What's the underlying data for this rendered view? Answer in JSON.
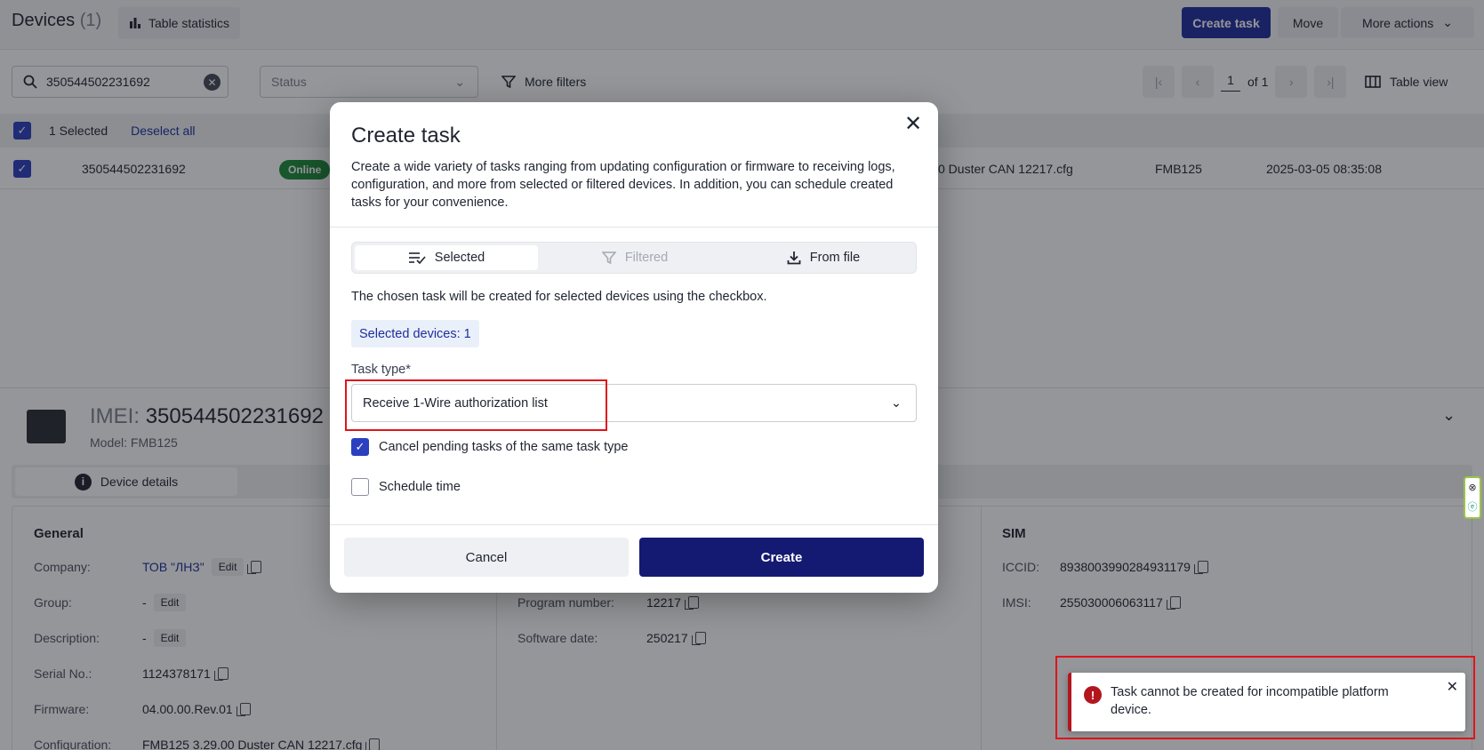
{
  "header": {
    "title": "Devices",
    "count": "(1)",
    "stats_label": "Table statistics",
    "create_task_label": "Create task",
    "move_label": "Move",
    "more_actions_label": "More actions"
  },
  "filters": {
    "search_value": "350544502231692",
    "status_placeholder": "Status",
    "more_filters_label": "More filters",
    "page_current": "1",
    "page_total": "of 1",
    "table_view_label": "Table view"
  },
  "selection": {
    "count_label": "1 Selected",
    "deselect_label": "Deselect all"
  },
  "table_row": {
    "imei": "350544502231692",
    "status": "Online",
    "configuration": "0 Duster CAN 12217.cfg",
    "model": "FMB125",
    "seen": "2025-03-05 08:35:08"
  },
  "details": {
    "imei_label": "IMEI:",
    "imei_value": "350544502231692",
    "model_text": "Model: FMB125",
    "tab_device_details": "Device details",
    "general_title": "General",
    "sim_title": "SIM",
    "general": [
      {
        "key": "Company:",
        "value": "ТОВ \"ЛНЗ\"",
        "edit": "Edit"
      },
      {
        "key": "Group:",
        "value": "-",
        "edit": "Edit"
      },
      {
        "key": "Description:",
        "value": "-",
        "edit": "Edit"
      },
      {
        "key": "Serial No.:",
        "value": "1124378171"
      },
      {
        "key": "Firmware:",
        "value": "04.00.00.Rev.01"
      },
      {
        "key": "Configuration:",
        "value": "FMB125 3.29.00 Duster CAN 12217.cfg"
      }
    ],
    "middle": [
      {
        "key": "Program number:",
        "value": "12217"
      },
      {
        "key": "Software date:",
        "value": "250217"
      }
    ],
    "sim": [
      {
        "key": "ICCID:",
        "value": "8938003990284931179"
      },
      {
        "key": "IMSI:",
        "value": "255030006063117"
      }
    ]
  },
  "modal": {
    "title": "Create task",
    "description": "Create a wide variety of tasks ranging from updating configuration or firmware to receiving logs, configuration, and more from selected or filtered devices. In addition, you can schedule created tasks for your convenience.",
    "tabs": [
      "Selected",
      "Filtered",
      "From file"
    ],
    "chosen_text": "The chosen task will be created for selected devices using the checkbox.",
    "selected_devices": "Selected devices: 1",
    "task_type_label": "Task type*",
    "task_type_value": "Receive 1-Wire authorization list",
    "cancel_pending_label": "Cancel pending tasks of the same task type",
    "cancel_pending_checked": true,
    "schedule_label": "Schedule time",
    "schedule_checked": false,
    "cancel_label": "Cancel",
    "create_label": "Create"
  },
  "toast": {
    "message": "Task cannot be created for incompatible platform device."
  },
  "colors": {
    "primary": "#1e2e9e",
    "create_button": "#141a72",
    "error": "#b3161e",
    "highlight": "#e0141b",
    "online": "#1c8a3a"
  }
}
